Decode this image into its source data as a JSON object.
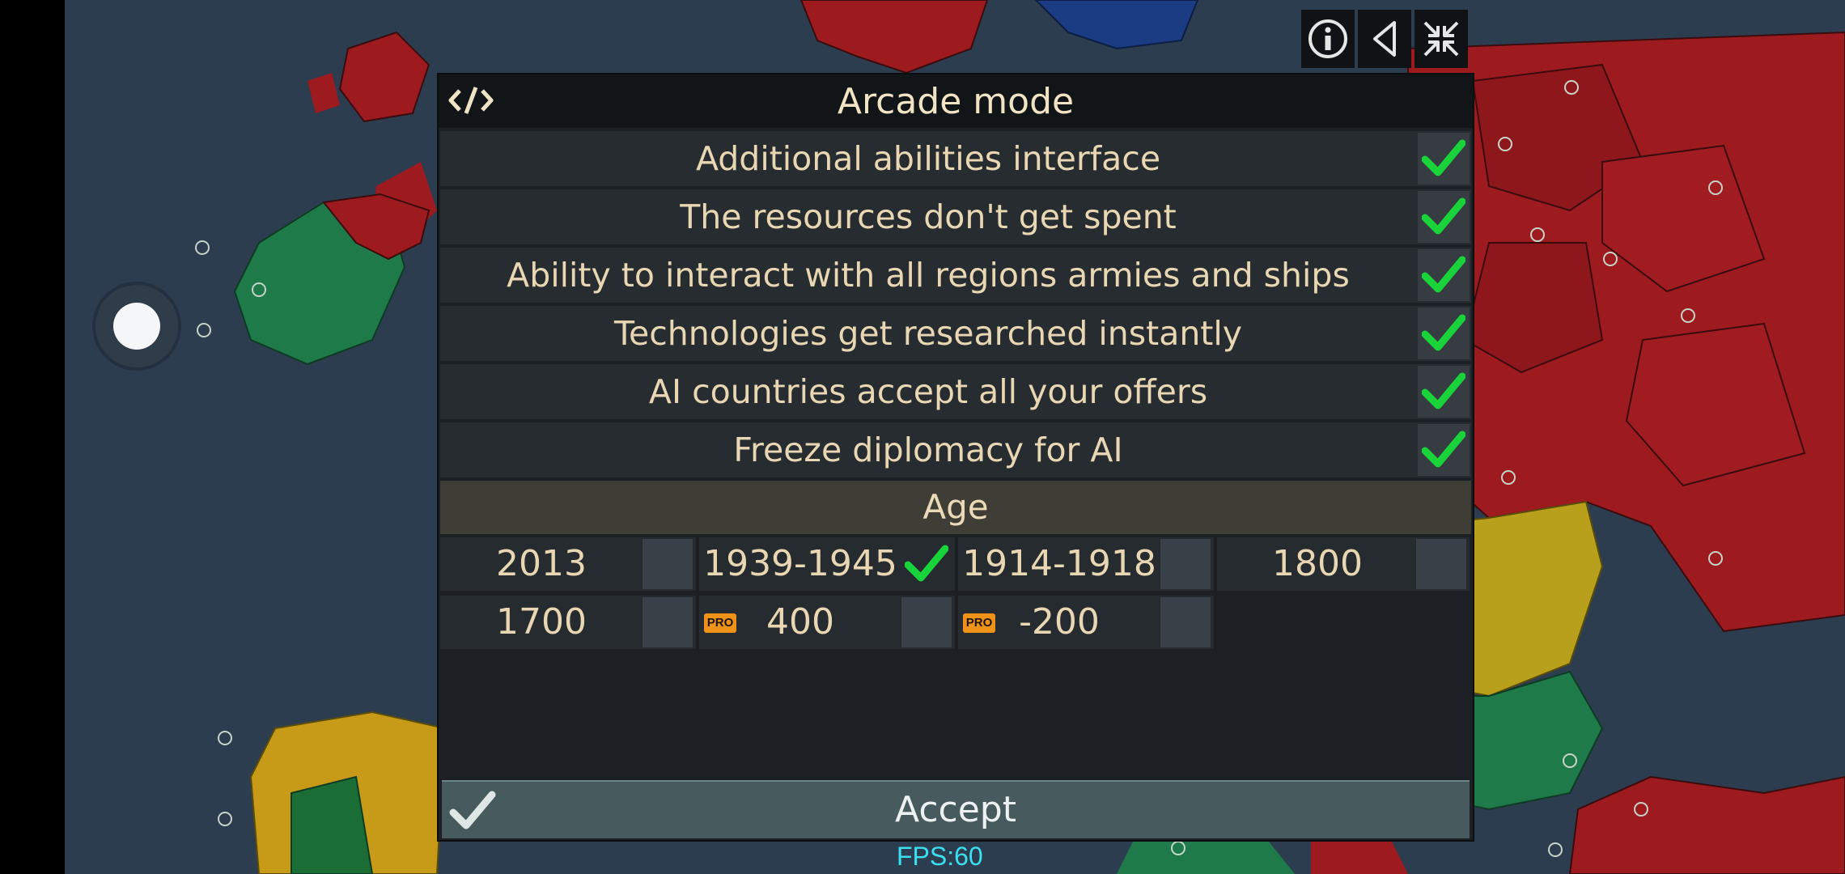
{
  "dialog": {
    "title": "Arcade mode",
    "options": [
      {
        "label": "Additional abilities interface",
        "checked": true
      },
      {
        "label": "The resources don't get spent",
        "checked": true
      },
      {
        "label": "Ability to interact with all regions armies and ships",
        "checked": true
      },
      {
        "label": "Technologies get researched instantly",
        "checked": true
      },
      {
        "label": "AI countries accept all your offers",
        "checked": true
      },
      {
        "label": "Freeze diplomacy for AI",
        "checked": true
      }
    ],
    "age": {
      "header": "Age",
      "items": [
        {
          "label": "2013",
          "checked": false,
          "pro": false
        },
        {
          "label": "1939-1945",
          "checked": true,
          "pro": false
        },
        {
          "label": "1914-1918",
          "checked": false,
          "pro": false
        },
        {
          "label": "1800",
          "checked": false,
          "pro": false
        },
        {
          "label": "1700",
          "checked": false,
          "pro": false
        },
        {
          "label": "400",
          "checked": false,
          "pro": true
        },
        {
          "label": "-200",
          "checked": false,
          "pro": true
        }
      ],
      "pro_badge": "PRO"
    },
    "accept_label": "Accept"
  },
  "fps": "FPS:60",
  "colors": {
    "check": "#18d43a",
    "pro_badge": "#ef9318",
    "fps": "#39e0f0"
  },
  "icons": {
    "top_buttons": [
      "info-icon",
      "back-arrow-icon",
      "fullscreen-exit-icon"
    ]
  }
}
